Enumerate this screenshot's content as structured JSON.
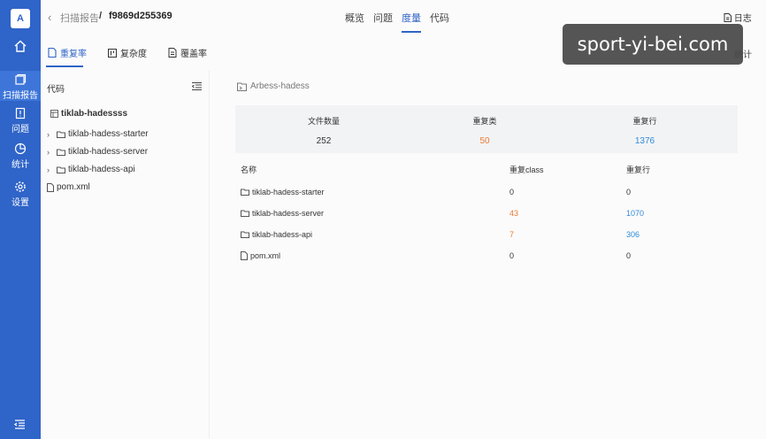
{
  "rail": {
    "avatar": "A",
    "active_label": "扫描报告",
    "items": [
      {
        "label": "问题",
        "icon": "issues-icon"
      },
      {
        "label": "统计",
        "icon": "statistics-icon"
      },
      {
        "label": "设置",
        "icon": "settings-icon"
      }
    ]
  },
  "header": {
    "crumb": "扫描报告",
    "separator": "/",
    "hash": "f9869d255369",
    "tabs": [
      "概览",
      "问题",
      "度量",
      "代码"
    ],
    "active_tab": "度量",
    "log_label": "日志"
  },
  "subtabs": [
    "重复率",
    "复杂度",
    "覆盖率"
  ],
  "stat_right": "统计",
  "tree": {
    "title": "代码",
    "root": "tiklab-hadessss",
    "items": [
      "tiklab-hadess-starter",
      "tiklab-hadess-server",
      "tiklab-hadess-api"
    ],
    "file": "pom.xml"
  },
  "project": "Arbess-hadess",
  "summary": {
    "files_label": "文件数量",
    "files": "252",
    "dup_class_label": "重复类",
    "dup_class": "50",
    "dup_lines_label": "重复行",
    "dup_lines": "1376"
  },
  "table": {
    "headers": [
      "名称",
      "重复class",
      "重复行"
    ],
    "rows": [
      {
        "name": "tiklab-hadess-starter",
        "cls": "0",
        "lines": "0"
      },
      {
        "name": "tiklab-hadess-server",
        "cls": "43",
        "lines": "1070"
      },
      {
        "name": "tiklab-hadess-api",
        "cls": "7",
        "lines": "306"
      },
      {
        "name": "pom.xml",
        "cls": "0",
        "lines": "0"
      }
    ]
  },
  "watermark": "sport-yi-bei.com",
  "colors": {
    "accent": "#2f64c8",
    "orange": "#e67c36",
    "blue": "#2f8ad9"
  }
}
